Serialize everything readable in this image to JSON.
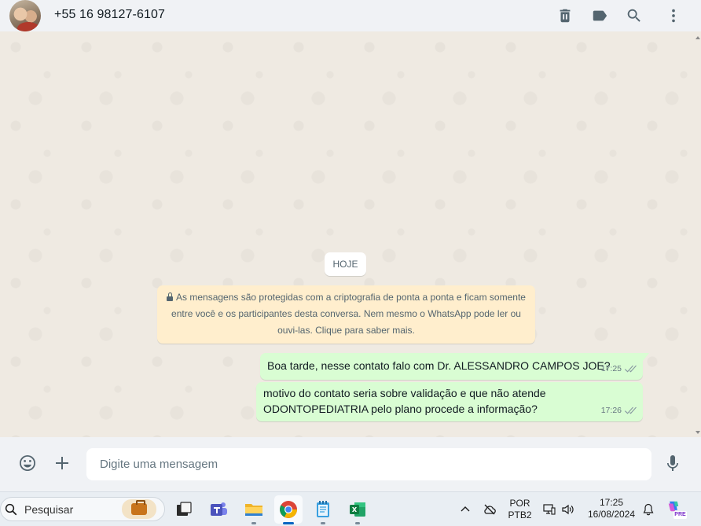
{
  "header": {
    "contact_name": "+55 16 98127-6107",
    "icons": [
      "delete-icon",
      "label-icon",
      "search-icon",
      "menu-icon"
    ]
  },
  "chat": {
    "date_chip": "HOJE",
    "encryption_notice": "As mensagens são protegidas com a criptografia de ponta a ponta e ficam somente entre você e os participantes desta conversa. Nem mesmo o WhatsApp pode ler ou ouvi-las. Clique para saber mais.",
    "messages": [
      {
        "text": "Boa tarde, nesse contato falo com Dr. ALESSANDRO CAMPOS JOE?",
        "time": "17:25",
        "status": "delivered"
      },
      {
        "text": "motivo do contato seria sobre validação e que não atende ODONTOPEDIATRIA pelo plano procede a informação?",
        "time": "17:26",
        "status": "delivered"
      }
    ]
  },
  "composer": {
    "placeholder": "Digite uma mensagem",
    "icons": [
      "emoji-icon",
      "plus-icon",
      "microphone-icon"
    ]
  },
  "taskbar": {
    "search_placeholder": "Pesquisar",
    "apps": [
      "task-view",
      "teams",
      "file-explorer",
      "chrome",
      "notepad",
      "excel"
    ],
    "active_app": "chrome",
    "language_line1": "POR",
    "language_line2": "PTB2",
    "time": "17:25",
    "date": "16/08/2024",
    "copilot_badge": "PRE"
  },
  "colors": {
    "header_bg": "#f0f2f5",
    "chat_bg": "#efeae2",
    "outgoing_bubble": "#d9fdd3",
    "notice_bg": "#ffeecd",
    "tick_color": "#8696a0"
  }
}
